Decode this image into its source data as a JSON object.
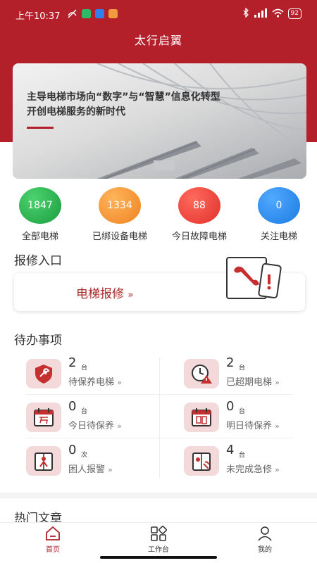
{
  "status_bar": {
    "time": "上午10:37",
    "battery": "92"
  },
  "app": {
    "title": "太行启翼"
  },
  "banner": {
    "line1": "主导电梯市场向“数字”与“智慧”信息化转型",
    "line2": "开创电梯服务的新时代"
  },
  "stats": [
    {
      "value": "1847",
      "label": "全部电梯",
      "color": "#1fa84a"
    },
    {
      "value": "1334",
      "label": "已绑设备电梯",
      "color": "#f0912e"
    },
    {
      "value": "88",
      "label": "今日故障电梯",
      "color": "#e4322c"
    },
    {
      "value": "0",
      "label": "关注电梯",
      "color": "#1e88e5"
    }
  ],
  "repair": {
    "section_title": "报修入口",
    "link_label": "电梯报修",
    "arrow": "»"
  },
  "todo": {
    "section_title": "待办事项",
    "items": [
      {
        "count": "2",
        "unit": "台",
        "label": "待保养电梯",
        "arrow": "»",
        "icon": "shield-wrench-icon"
      },
      {
        "count": "2",
        "unit": "台",
        "label": "已超期电梯",
        "arrow": "»",
        "icon": "clock-warning-icon"
      },
      {
        "count": "0",
        "unit": "台",
        "label": "今日待保养",
        "arrow": "»",
        "icon": "calendar-today-icon"
      },
      {
        "count": "0",
        "unit": "台",
        "label": "明日待保养",
        "arrow": "»",
        "icon": "calendar-tomorrow-icon"
      },
      {
        "count": "0",
        "unit": "次",
        "label": "困人报警",
        "arrow": "»",
        "icon": "trapped-alarm-icon"
      },
      {
        "count": "4",
        "unit": "台",
        "label": "未完成急修",
        "arrow": "»",
        "icon": "urgent-repair-icon"
      }
    ]
  },
  "articles": {
    "section_title": "热门文章"
  },
  "tabbar": [
    {
      "label": "首页",
      "icon": "home-icon",
      "active": true
    },
    {
      "label": "工作台",
      "icon": "workbench-icon",
      "active": false
    },
    {
      "label": "我的",
      "icon": "user-icon",
      "active": false
    }
  ],
  "colors": {
    "brand_red": "#b3202a",
    "link_red": "#a82a2a",
    "icon_bg": "#f3d9da"
  }
}
